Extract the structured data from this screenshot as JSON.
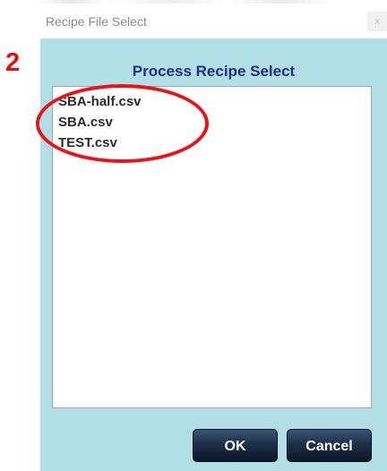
{
  "window": {
    "title": "Recipe File Select",
    "close_glyph": "x"
  },
  "dialog": {
    "heading": "Process Recipe Select",
    "files": [
      "SBA-half.csv",
      "SBA.csv",
      "TEST.csv"
    ],
    "ok_label": "OK",
    "cancel_label": "Cancel"
  },
  "annotation": {
    "step_number": "2",
    "color": "#e8141c"
  },
  "colors": {
    "client_background": "#b2dfe6",
    "heading": "#1e2f8a",
    "button": "#1e2f48"
  }
}
